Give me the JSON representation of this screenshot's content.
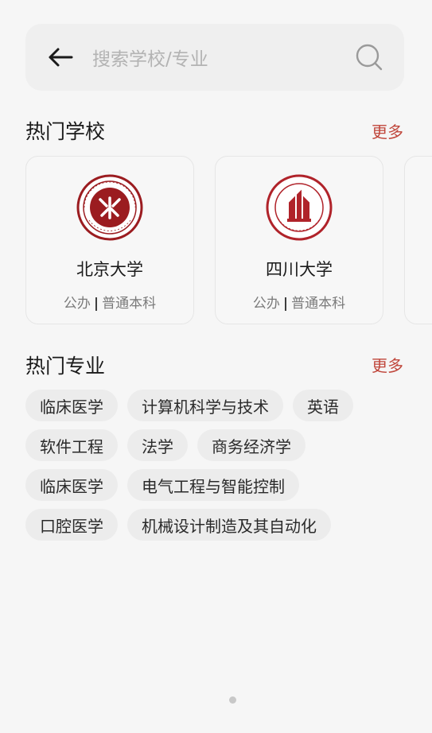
{
  "search": {
    "placeholder": "搜索学校/专业",
    "back_icon": "arrow-left-icon",
    "search_icon": "search-icon"
  },
  "hot_schools": {
    "title": "热门学校",
    "more_label": "更多",
    "items": [
      {
        "name": "北京大学",
        "type": "公办",
        "level": "普通本科",
        "logo": "peking-university-seal",
        "logo_color": "#9b1c20"
      },
      {
        "name": "四川大学",
        "type": "公办",
        "level": "普通本科",
        "logo": "sichuan-university-seal",
        "logo_color": "#b0232a"
      }
    ]
  },
  "hot_majors": {
    "title": "热门专业",
    "more_label": "更多",
    "rows": [
      [
        "临床医学",
        "计算机科学与技术",
        "英语"
      ],
      [
        "软件工程",
        "法学",
        "商务经济学"
      ],
      [
        "临床医学",
        "电气工程与智能控制"
      ],
      [
        "口腔医学",
        "机械设计制造及其自动化"
      ]
    ]
  },
  "colors": {
    "accent": "#c0463b",
    "background": "#f6f6f6",
    "tag_bg": "#ececec"
  }
}
